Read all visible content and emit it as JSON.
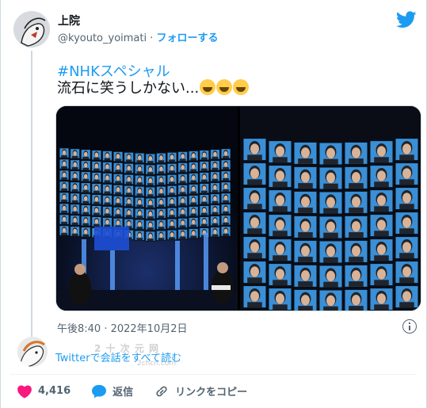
{
  "author": {
    "display_name": "上院",
    "handle": "@kyouto_yoimati",
    "separator": " · ",
    "follow_label": "フォローする"
  },
  "tweet": {
    "hashtag": "#NHKスペシャル",
    "text": "流石に笑うしかない...",
    "emoji_names": [
      "rofl-emoji",
      "rofl-emoji",
      "rofl-emoji"
    ],
    "timestamp": "午後8:40 · 2022年10月2日"
  },
  "media": {
    "photo_count": 2,
    "tile_color": "#3a8fd6"
  },
  "thread": {
    "read_conversation_label": "Twitterで会話をすべて読む"
  },
  "watermark": {
    "text": "2 十 次 元 网",
    "url": "2chcn.com"
  },
  "actions": {
    "like_count": "4,416",
    "reply_label": "返信",
    "copy_link_label": "リンクをコピー"
  },
  "colors": {
    "accent": "#1d9bf0",
    "like": "#f91880",
    "muted": "#536471"
  },
  "icons": [
    "twitter-bird-icon",
    "info-icon",
    "heart-icon",
    "reply-icon",
    "link-icon"
  ]
}
